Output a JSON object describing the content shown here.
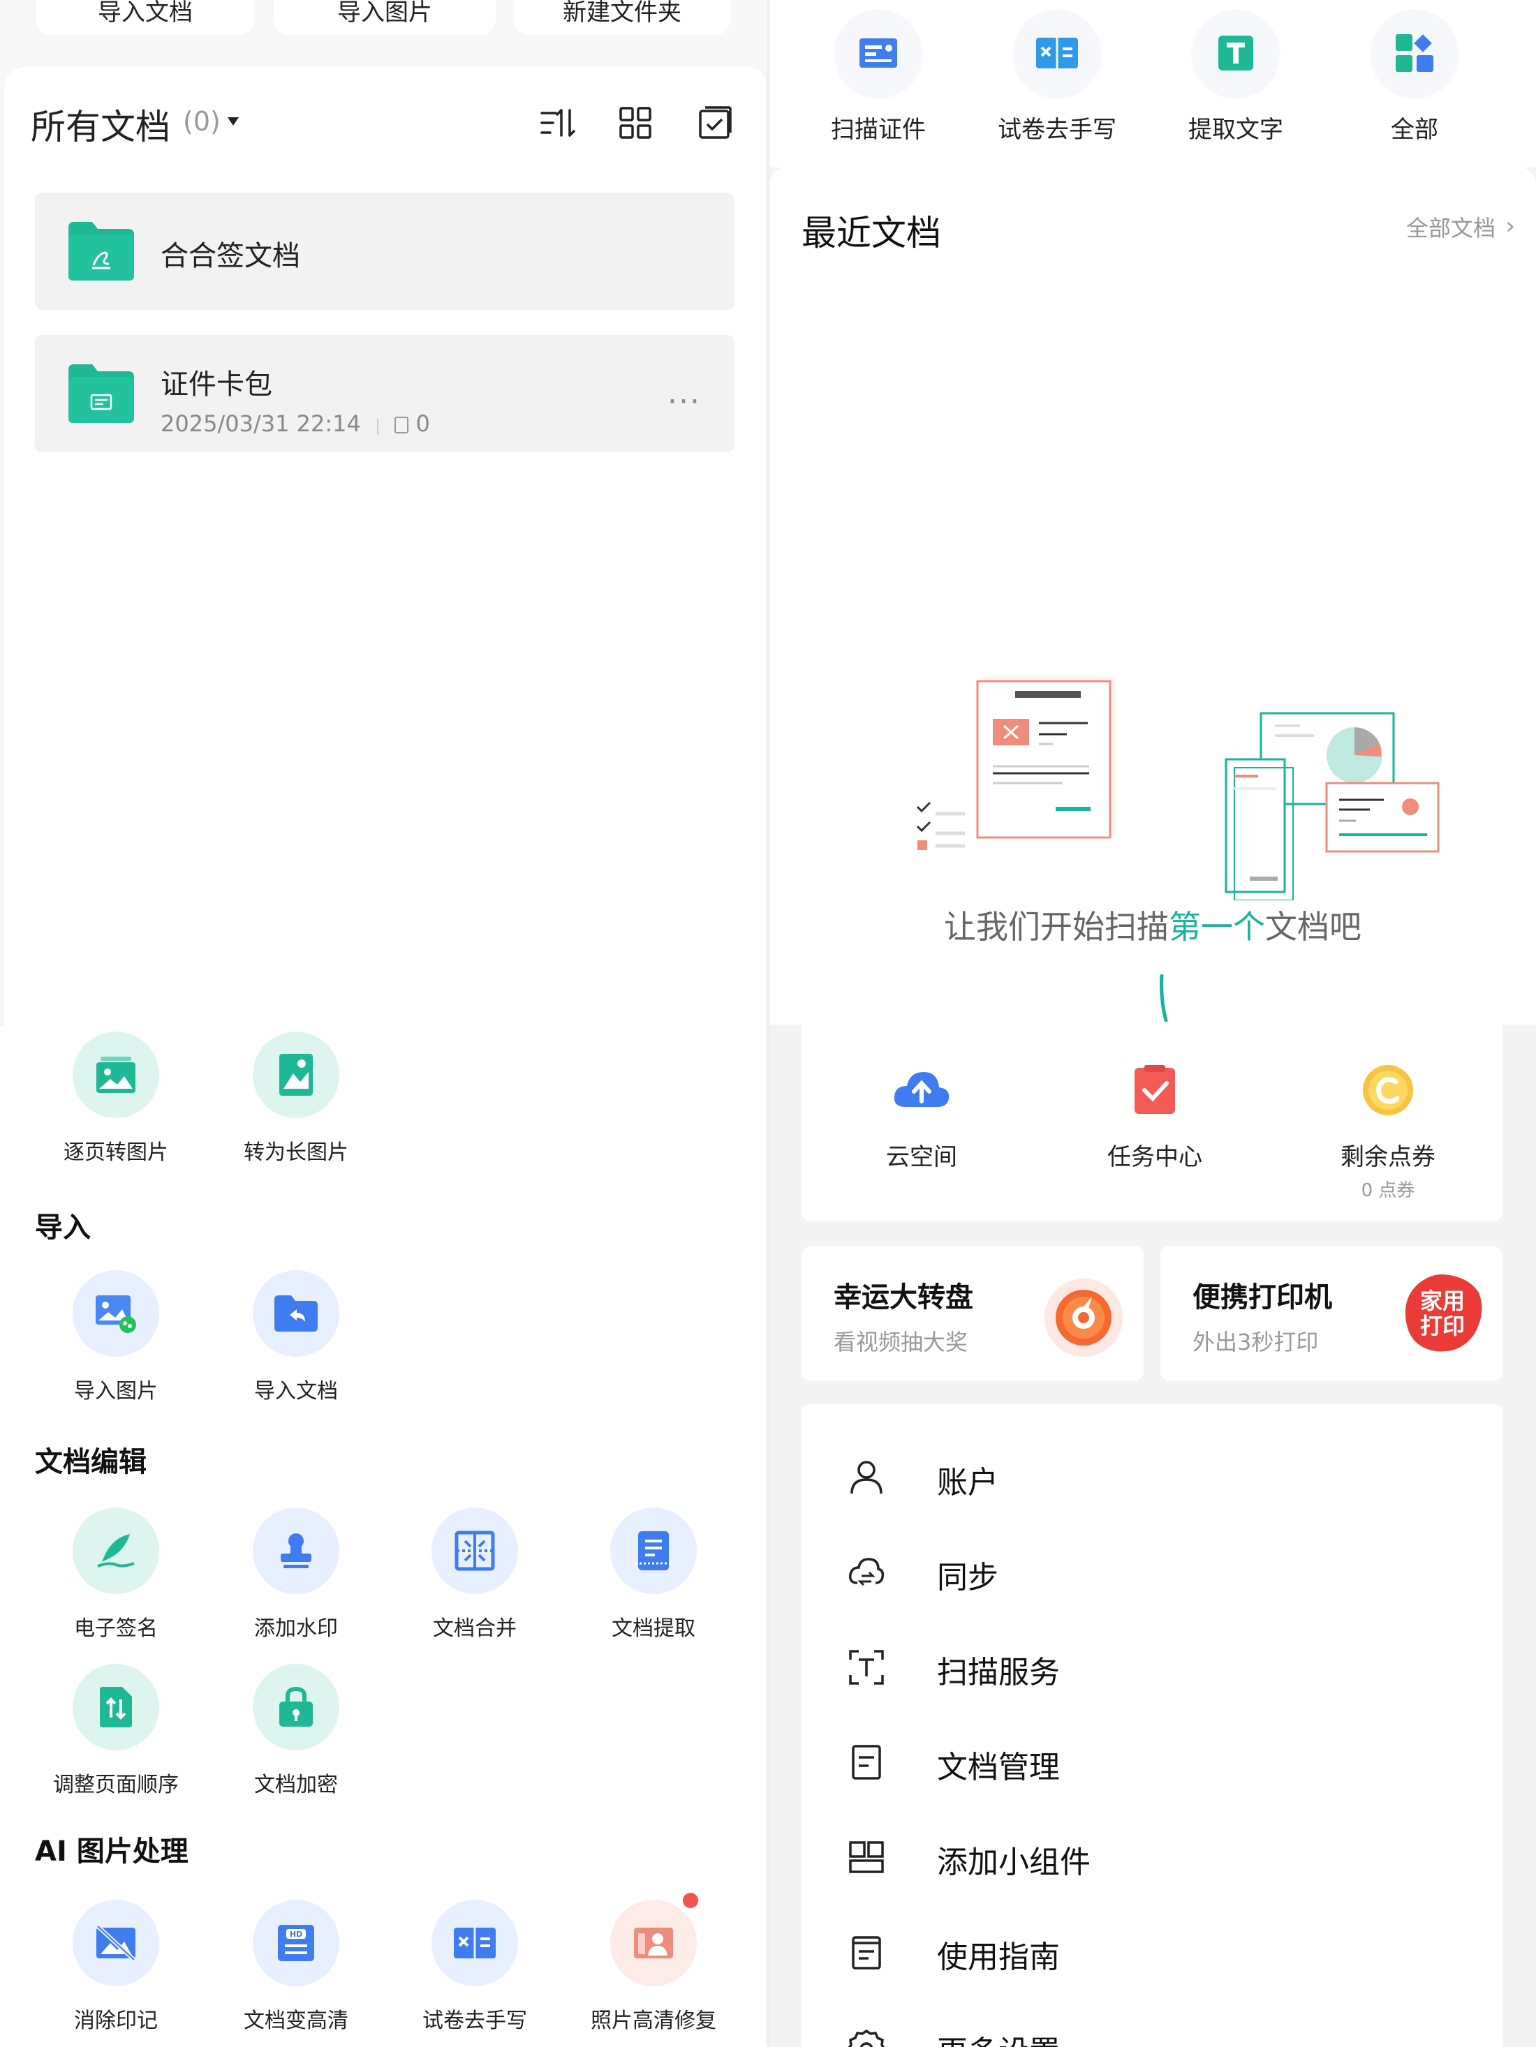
{
  "left": {
    "top_buttons": [
      "导入文档",
      "导入图片",
      "新建文件夹"
    ],
    "docs_header": {
      "title": "所有文档",
      "count": "(0)"
    },
    "folders": [
      {
        "name": "合合签文档",
        "meta_date": "",
        "meta_count": ""
      },
      {
        "name": "证件卡包",
        "meta_date": "2025/03/31 22:14",
        "meta_count": "0"
      }
    ],
    "convert_tools": [
      {
        "label": "逐页转图片",
        "icon": "image-stack-icon"
      },
      {
        "label": "转为长图片",
        "icon": "long-image-icon"
      }
    ],
    "sections": {
      "import": "导入",
      "edit": "文档编辑",
      "ai": "AI 图片处理"
    },
    "import_tools": [
      {
        "label": "导入图片",
        "icon": "import-image-icon"
      },
      {
        "label": "导入文档",
        "icon": "import-doc-icon"
      }
    ],
    "edit_tools": [
      {
        "label": "电子签名",
        "icon": "signature-icon"
      },
      {
        "label": "添加水印",
        "icon": "watermark-icon"
      },
      {
        "label": "文档合并",
        "icon": "merge-icon"
      },
      {
        "label": "文档提取",
        "icon": "extract-icon"
      },
      {
        "label": "调整页面顺序",
        "icon": "reorder-icon"
      },
      {
        "label": "文档加密",
        "icon": "lock-icon"
      }
    ],
    "ai_tools": [
      {
        "label": "消除印记",
        "icon": "remove-mark-icon"
      },
      {
        "label": "文档变高清",
        "icon": "hd-icon"
      },
      {
        "label": "试卷去手写",
        "icon": "exam-icon"
      },
      {
        "label": "照片高清修复",
        "icon": "photo-repair-icon"
      }
    ]
  },
  "right": {
    "quick_actions": [
      {
        "label": "扫描证件",
        "icon": "id-card-icon"
      },
      {
        "label": "试卷去手写",
        "icon": "exam-icon"
      },
      {
        "label": "提取文字",
        "icon": "text-extract-icon"
      },
      {
        "label": "全部",
        "icon": "all-apps-icon"
      }
    ],
    "recent": {
      "title": "最近文档",
      "all_link": "全部文档",
      "empty_prefix": "让我们开始扫描",
      "empty_highlight": "第一个",
      "empty_suffix": "文档吧"
    },
    "services": [
      {
        "label": "云空间",
        "sub": "",
        "icon": "cloud-upload-icon"
      },
      {
        "label": "任务中心",
        "sub": "",
        "icon": "task-icon"
      },
      {
        "label": "剩余点券",
        "sub": "0 点券",
        "icon": "coupon-icon"
      }
    ],
    "promos": [
      {
        "title": "幸运大转盘",
        "sub": "看视频抽大奖",
        "icon": "wheel-icon"
      },
      {
        "title": "便携打印机",
        "sub": "外出3秒打印",
        "badge": "家用打印",
        "icon": "printer-badge-icon"
      }
    ],
    "menu": [
      {
        "label": "账户",
        "icon": "user-icon"
      },
      {
        "label": "同步",
        "icon": "sync-icon"
      },
      {
        "label": "扫描服务",
        "icon": "scan-service-icon"
      },
      {
        "label": "文档管理",
        "icon": "doc-manage-icon"
      },
      {
        "label": "添加小组件",
        "icon": "widget-icon"
      },
      {
        "label": "使用指南",
        "icon": "guide-icon"
      },
      {
        "label": "更多设置",
        "icon": "settings-icon"
      }
    ]
  },
  "colors": {
    "teal": "#17b39a",
    "folder_green": "#1fb896",
    "blue": "#3b82f6",
    "red": "#f25a55",
    "orange": "#f5a623",
    "coral": "#f08c7c"
  }
}
